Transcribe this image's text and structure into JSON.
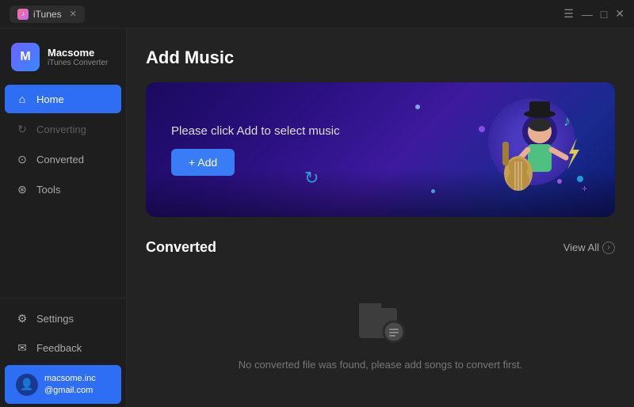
{
  "titlebar": {
    "tab_label": "iTunes",
    "tab_close": "✕",
    "controls": {
      "menu": "☰",
      "minimize": "—",
      "maximize": "□",
      "close": "✕"
    }
  },
  "sidebar": {
    "brand": {
      "name": "Macsome",
      "subtitle": "iTunes Converter"
    },
    "nav": [
      {
        "id": "home",
        "label": "Home",
        "icon": "⌂",
        "active": true,
        "disabled": false
      },
      {
        "id": "converting",
        "label": "Converting",
        "icon": "↻",
        "active": false,
        "disabled": true
      },
      {
        "id": "converted",
        "label": "Converted",
        "icon": "⊙",
        "active": false,
        "disabled": false
      },
      {
        "id": "tools",
        "label": "Tools",
        "icon": "⊛",
        "active": false,
        "disabled": false
      }
    ],
    "bottom_nav": [
      {
        "id": "settings",
        "label": "Settings",
        "icon": "⚙"
      },
      {
        "id": "feedback",
        "label": "Feedback",
        "icon": "✉"
      }
    ],
    "user": {
      "email_line1": "macsome.inc",
      "email_line2": "@gmail.com",
      "avatar_icon": "👤"
    }
  },
  "content": {
    "page_title": "Add Music",
    "hero": {
      "description": "Please click Add to select music",
      "add_button": "+ Add"
    },
    "converted_section": {
      "title": "Converted",
      "view_all_label": "View All",
      "empty_message": "No converted file was found, please add songs to convert first."
    }
  }
}
